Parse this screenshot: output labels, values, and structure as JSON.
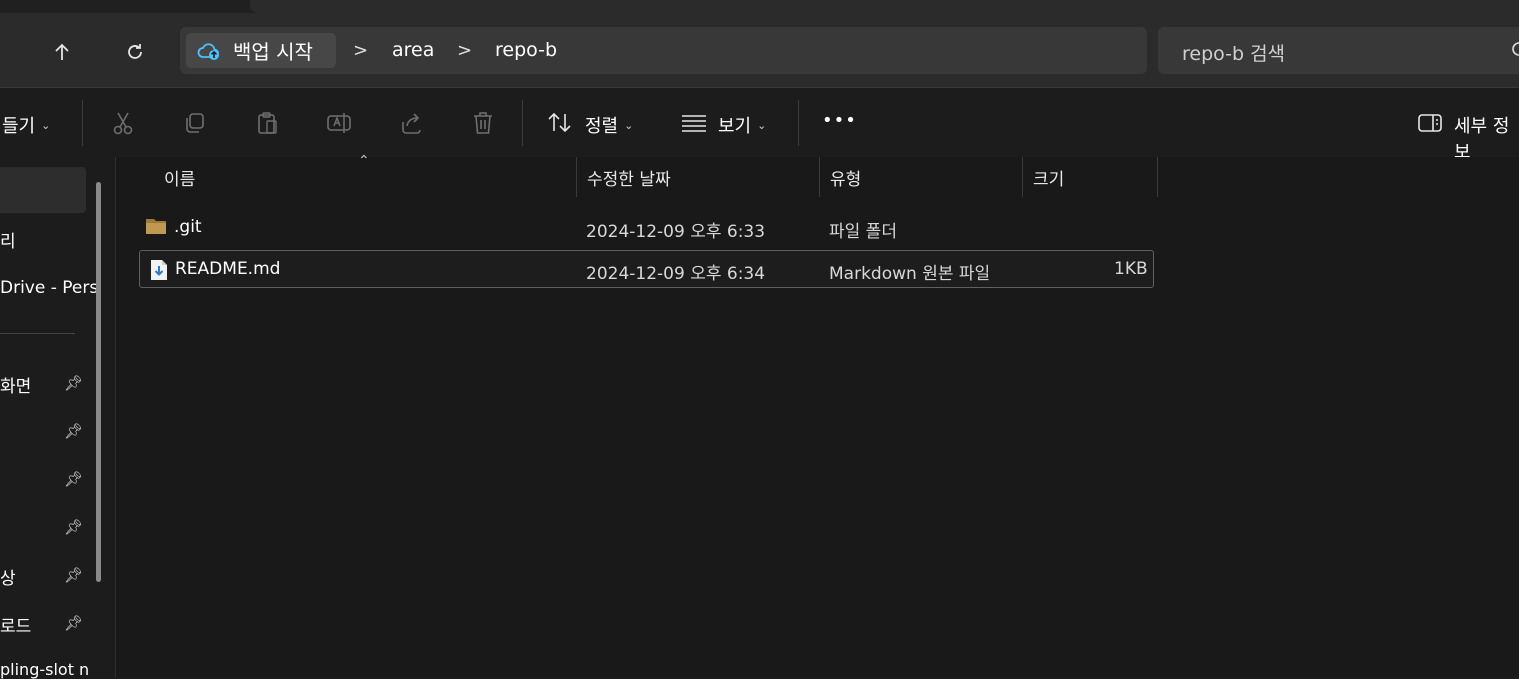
{
  "colors": {
    "accent": "#4cc2ff",
    "folder": "#c09853",
    "background": "#191919"
  },
  "address": {
    "home_label": "백업 시작",
    "crumbs": [
      "area",
      "repo-b"
    ],
    "separator": ">",
    "search_placeholder": "repo-b 검색"
  },
  "nav": {
    "up_icon": "arrow-up-icon",
    "refresh_icon": "refresh-icon"
  },
  "toolbar": {
    "new_label": "들기",
    "sort_label": "정렬",
    "view_label": "보기",
    "more_label": "•••",
    "details_label": "세부 정보"
  },
  "sidebar": {
    "items": [
      {
        "label": "리",
        "pinned": false
      },
      {
        "label": "Drive - Pers",
        "pinned": false
      },
      {
        "label": "화면",
        "pinned": true
      },
      {
        "label": "",
        "pinned": true
      },
      {
        "label": "",
        "pinned": true
      },
      {
        "label": "",
        "pinned": true
      },
      {
        "label": "상",
        "pinned": true
      },
      {
        "label": "로드",
        "pinned": true
      },
      {
        "label": "pling-slot n",
        "pinned": false
      }
    ]
  },
  "columns": {
    "name": "이름",
    "modified": "수정한 날짜",
    "type": "유형",
    "size": "크기"
  },
  "files": [
    {
      "name": ".git",
      "modified": "2024-12-09 오후 6:33",
      "type": "파일 폴더",
      "size": "",
      "icon": "folder-icon"
    },
    {
      "name": "README.md",
      "modified": "2024-12-09 오후 6:34",
      "type": "Markdown 원본 파일",
      "size": "1KB",
      "icon": "markdown-file-icon"
    }
  ]
}
